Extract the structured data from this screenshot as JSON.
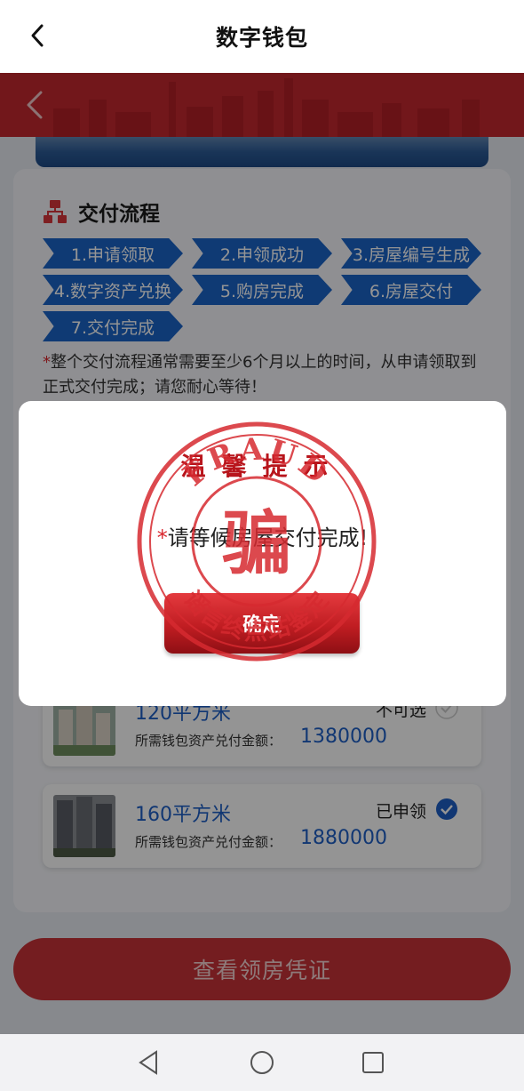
{
  "app": {
    "title": "数字钱包"
  },
  "flow": {
    "title": "交付流程",
    "steps": [
      "1.申请领取",
      "2.申领成功",
      "3.房屋编号生成",
      "4.数字资产兑换",
      "5.购房完成",
      "6.房屋交付",
      "7.交付完成"
    ],
    "note_star": "*",
    "note": "整个交付流程通常需要至少6个月以上的时间，从申请领取到正式交付完成；请您耐心等待！"
  },
  "houses": [
    {
      "size": "120平方米",
      "amount_label": "所需钱包资产兑付金额：",
      "amount": "1380000",
      "state": "不可选"
    },
    {
      "size": "160平方米",
      "amount_label": "所需钱包资产兑付金额：",
      "amount": "1880000",
      "state": "已申领"
    }
  ],
  "bottom_button": "查看领房凭证",
  "modal": {
    "title": "温馨提示",
    "message_star": "*",
    "message": "请等候房屋交付完成!",
    "confirm": "确定"
  },
  "stamp": {
    "top_text": "FRAUD",
    "center_char": "骗",
    "bottom_text": "谣言终点站鉴定"
  },
  "colors": {
    "brand_red": "#c4282f",
    "step_blue": "#1b64c9",
    "link_blue": "#1e5fc6",
    "alert_red": "#b8151c"
  },
  "icons": [
    "chevron-left-icon",
    "flow-chart-icon",
    "check-circle-icon",
    "nav-back-icon",
    "nav-home-icon",
    "nav-recents-icon"
  ]
}
